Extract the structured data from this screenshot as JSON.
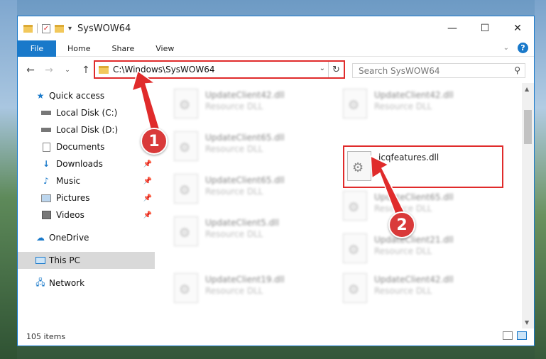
{
  "window": {
    "title": "SysWOW64",
    "controls": {
      "minimize": "—",
      "maximize": "☐",
      "close": "✕"
    }
  },
  "ribbon": {
    "tabs": [
      {
        "label": "File"
      },
      {
        "label": "Home"
      },
      {
        "label": "Share"
      },
      {
        "label": "View"
      }
    ],
    "help_label": "?"
  },
  "address_bar": {
    "path": "C:\\Windows\\SysWOW64"
  },
  "search": {
    "placeholder": "Search SysWOW64"
  },
  "sidebar": {
    "items": [
      {
        "label": "Quick access",
        "icon": "star-icon"
      },
      {
        "label": "Local Disk (C:)",
        "icon": "drive-icon"
      },
      {
        "label": "Local Disk (D:)",
        "icon": "drive-icon"
      },
      {
        "label": "Documents",
        "icon": "documents-icon",
        "pinned": true
      },
      {
        "label": "Downloads",
        "icon": "download-icon",
        "pinned": true
      },
      {
        "label": "Music",
        "icon": "music-icon",
        "pinned": true
      },
      {
        "label": "Pictures",
        "icon": "pictures-icon",
        "pinned": true
      },
      {
        "label": "Videos",
        "icon": "videos-icon",
        "pinned": true
      },
      {
        "label": "OneDrive",
        "icon": "cloud-icon"
      },
      {
        "label": "This PC",
        "icon": "computer-icon",
        "selected": true
      },
      {
        "label": "Network",
        "icon": "network-icon"
      }
    ]
  },
  "files": [
    {
      "name": "UpdateClient42.dll",
      "type": "Resource DLL"
    },
    {
      "name": "UpdateClient42.dll",
      "type": "Resource DLL"
    },
    {
      "name": "UpdateClient65.dll",
      "type": "Resource DLL"
    },
    {
      "name": "icqfeatures.dll",
      "type": ""
    },
    {
      "name": "UpdateClient65.dll",
      "type": "Resource DLL"
    },
    {
      "name": "UpdateClient65.dll",
      "type": "Resource DLL"
    },
    {
      "name": "UpdateClient5.dll",
      "type": "Resource DLL"
    },
    {
      "name": "UpdateClient21.dll",
      "type": "Resource DLL"
    },
    {
      "name": "UpdateClient19.dll",
      "type": "Resource DLL"
    },
    {
      "name": "UpdateClient42.dll",
      "type": "Resource DLL"
    }
  ],
  "status": {
    "item_count": "105 items"
  },
  "annotations": {
    "step1": "1",
    "step2": "2",
    "color": "#e02b2b"
  }
}
